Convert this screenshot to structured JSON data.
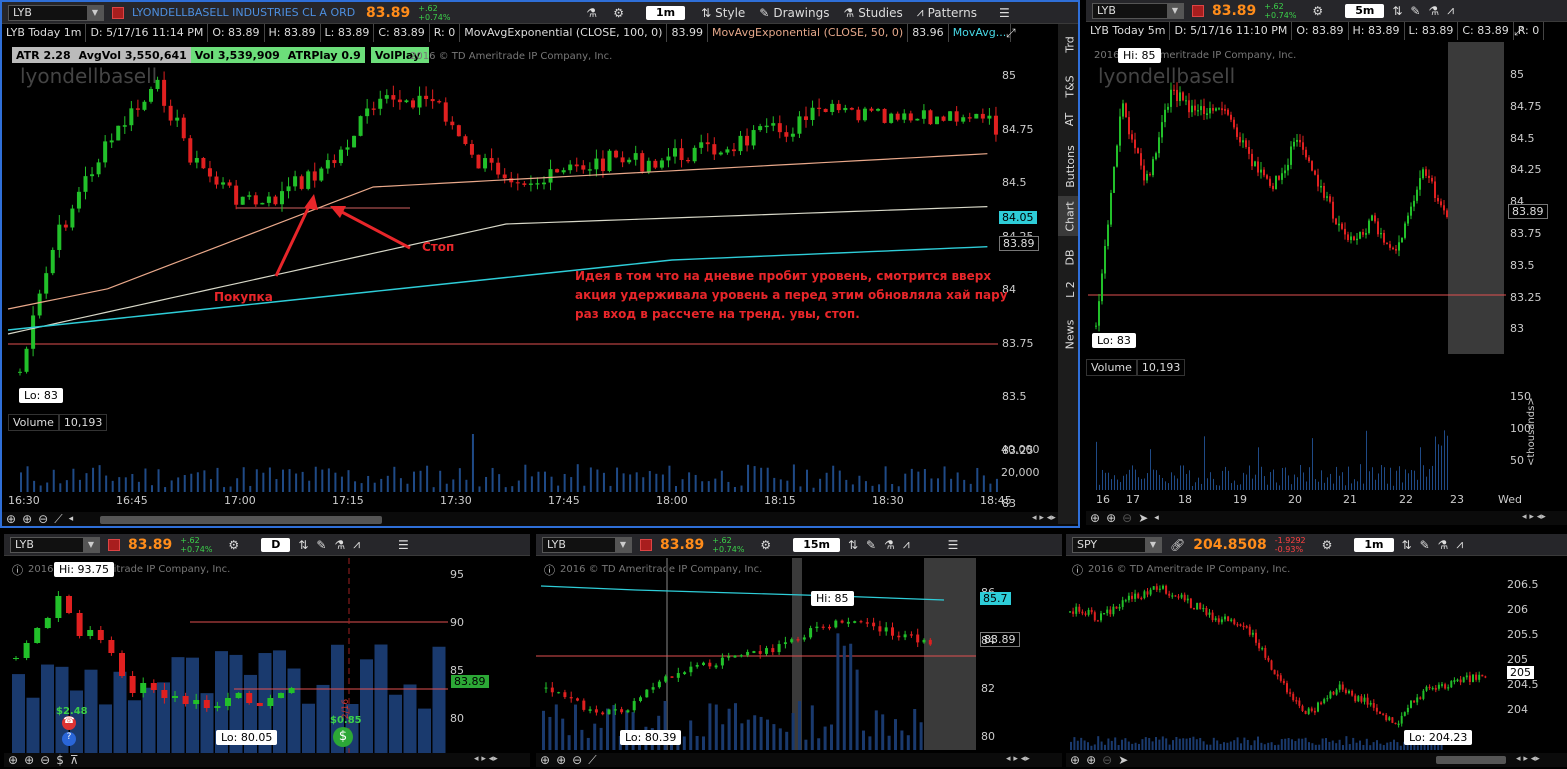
{
  "main": {
    "symbol": "LYB",
    "company": "LYONDELLBASELL INDUSTRIES CL A ORD",
    "price": "83.89",
    "change": "+.62",
    "change_pct": "+0.74%",
    "timeframe": "1m",
    "toolbar": {
      "style": "Style",
      "drawings": "Drawings",
      "studies": "Studies",
      "patterns": "Patterns"
    },
    "info": {
      "title": "LYB Today 1m",
      "date": "D: 5/17/16 11:14 PM",
      "o": "O: 83.89",
      "h": "H: 83.89",
      "l": "L: 83.89",
      "c": "C: 83.89",
      "r": "R: 0",
      "ma1": "MovAvgExponential (CLOSE, 100, 0)",
      "ma1_val": "83.99",
      "ma2": "MovAvgExponential (CLOSE, 50, 0)",
      "ma2_val": "83.96",
      "ma3": "MovAvg..."
    },
    "studies": {
      "atr": "ATR 2.28",
      "avgvol": "AvgVol 3,550,641",
      "vol": "Vol 3,539,909",
      "atrplay": "ATRPlay 0.9",
      "volplay": "VolPlay 1"
    },
    "copyright": "2016 © TD Ameritrade IP Company, Inc.",
    "watermark": "lyondellbasell",
    "yaxis": [
      "85",
      "84.75",
      "84.5",
      "84.25",
      "84",
      "83.75",
      "83.5",
      "83.25",
      "83"
    ],
    "tag_cyan": "84.05",
    "tag_white": "83.89",
    "lo": "Lo: 83",
    "volume": {
      "label": "Volume",
      "value": "10,193",
      "ticks": [
        "40,000",
        "20,000"
      ]
    },
    "xaxis": [
      "16:30",
      "16:45",
      "17:00",
      "17:15",
      "17:30",
      "17:45",
      "18:00",
      "18:15",
      "18:30",
      "18:45"
    ],
    "ann_stop": "Стоп",
    "ann_buy": "Покупка",
    "note": [
      "Идея в том что на дневие пробит уровень, смотрится вверх",
      "акция удерживала уровень а перед этим обновляла хай пару",
      "раз вход в рассчете на тренд. увы, стоп."
    ],
    "tabs": [
      "Trd",
      "T&S",
      "AT",
      "Buttons",
      "Chart",
      "DB",
      "L 2",
      "News"
    ]
  },
  "right": {
    "symbol": "LYB",
    "price": "83.89",
    "change": "+.62",
    "change_pct": "+0.74%",
    "timeframe": "5m",
    "info": {
      "title": "LYB Today 5m",
      "date": "D: 5/17/16 11:10 PM",
      "o": "O: 83.89",
      "h": "H: 83.89",
      "l": "L: 83.89",
      "c": "C: 83.89",
      "r": "R: 0"
    },
    "copyright": "2016 © TD Ameritrade IP Company, Inc.",
    "watermark": "lyondellbasell",
    "yaxis": [
      "85",
      "84.75",
      "84.5",
      "84.25",
      "84",
      "83.75",
      "83.5",
      "83.25",
      "83"
    ],
    "tag": "83.89",
    "hi": "Hi: 85",
    "lo": "Lo: 83",
    "volume": {
      "label": "Volume",
      "value": "10,193",
      "ticks": [
        "150",
        "100",
        "50"
      ],
      "unit": "<thousands>"
    },
    "xaxis": [
      "16",
      "17",
      "18",
      "19",
      "20",
      "21",
      "22",
      "23",
      "Wed"
    ]
  },
  "bl": {
    "symbol": "LYB",
    "price": "83.89",
    "change": "+.62",
    "change_pct": "+0.74%",
    "timeframe": "D",
    "copyright": "2016 © TD Ameritrade IP Company, Inc.",
    "yaxis": [
      "95",
      "90",
      "85",
      "80"
    ],
    "tag": "83.89",
    "hi": "Hi: 93.75",
    "lo": "Lo: 80.05",
    "div": "$2.48",
    "div2": "$0.85",
    "date_mark": "2/16"
  },
  "bm": {
    "symbol": "LYB",
    "price": "83.89",
    "change": "+.62",
    "change_pct": "+0.74%",
    "timeframe": "15m",
    "copyright": "2016 © TD Ameritrade IP Company, Inc.",
    "yaxis": [
      "86",
      "84",
      "82",
      "80"
    ],
    "tag_cyan": "85.7",
    "tag": "83.89",
    "hi": "Hi: 85",
    "lo": "Lo: 80.39"
  },
  "br": {
    "symbol": "SPY",
    "price": "204.8508",
    "change": "-1.9292",
    "change_pct": "-0.93%",
    "timeframe": "1m",
    "copyright": "2016 © TD Ameritrade IP Company, Inc.",
    "yaxis": [
      "206.5",
      "206",
      "205.5",
      "205",
      "204.5",
      "204"
    ],
    "tag": "205",
    "lo": "Lo: 204.23"
  },
  "colors": {
    "up": "#22c02a",
    "down": "#e02020",
    "ma_slow": "#e9a88a",
    "ma_mid": "#d8d8c8",
    "ma_cyan": "#2ecdd8",
    "level": "#e05050",
    "volume": "#1f4a86"
  }
}
